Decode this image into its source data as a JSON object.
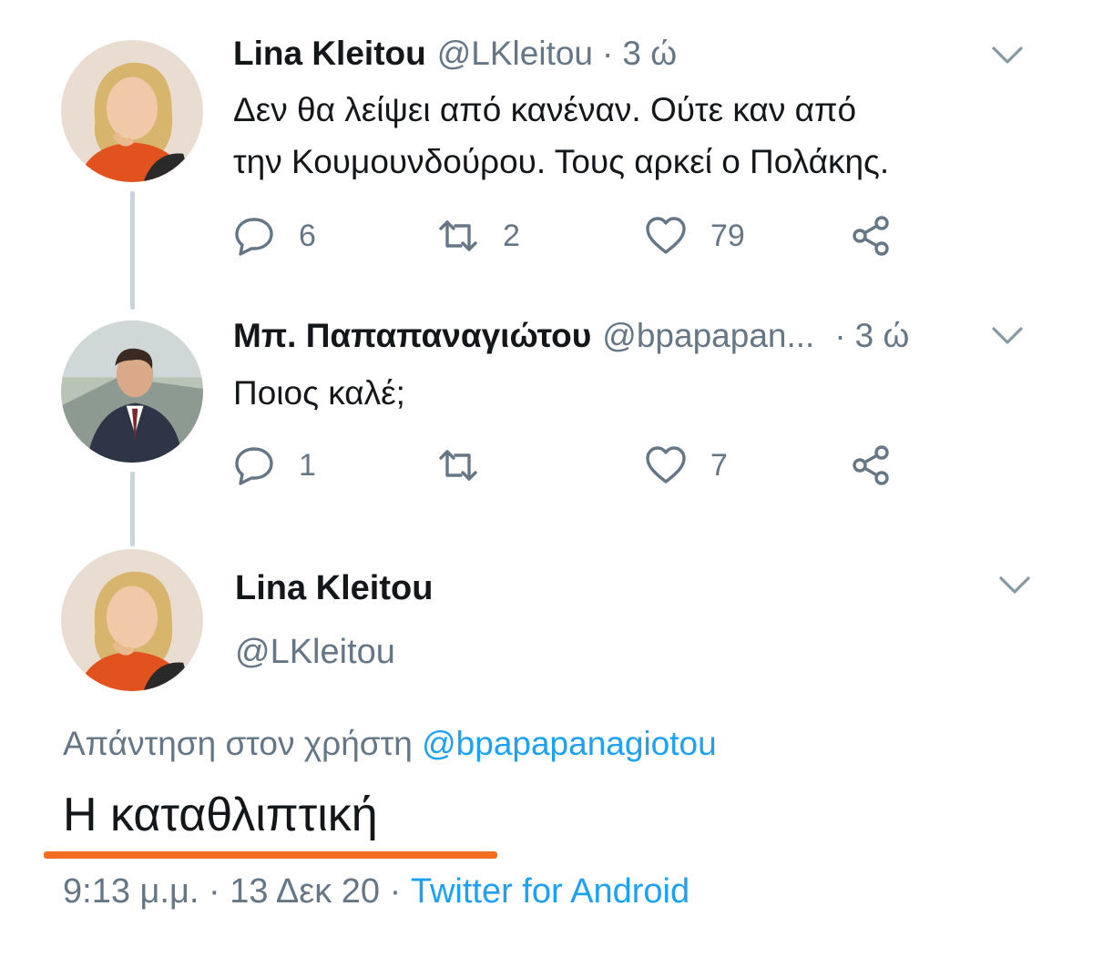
{
  "tweets": [
    {
      "name": "Lina Kleitou",
      "handle": "@LKleitou",
      "separator": "·",
      "time": "3 ώ",
      "text_lines": [
        "Δεν θα λείψει από κανέναν.  Ούτε καν από",
        "την Κουμουνδούρου. Τους αρκεί ο Πολάκης."
      ],
      "replies": "6",
      "retweets": "2",
      "likes": "79"
    },
    {
      "name": "Μπ. Παπαπαναγιώτου",
      "handle": "@bpapapan...",
      "separator": "·",
      "time": "3 ώ",
      "text_lines": [
        "Ποιος καλέ;"
      ],
      "replies": "1",
      "retweets": "",
      "likes": "7"
    }
  ],
  "focused": {
    "name": "Lina Kleitou",
    "handle": "@LKleitou",
    "reply_prefix": "Απάντηση στον χρήστη",
    "reply_mention": "@bpapapanagiotou",
    "text": "Η καταθλιπτική",
    "timestamp": "9:13 μ.μ. · 13 Δεκ 20 · ",
    "source": "Twitter for Android"
  },
  "icons": {
    "reply": "reply-icon",
    "retweet": "retweet-icon",
    "like": "heart-icon",
    "share": "share-icon",
    "menu": "chevron-down-icon"
  },
  "colors": {
    "text": "#14171a",
    "secondary": "#657786",
    "link": "#1da1f2",
    "thread_line": "#c7d4de",
    "highlight": "#f26f21"
  }
}
